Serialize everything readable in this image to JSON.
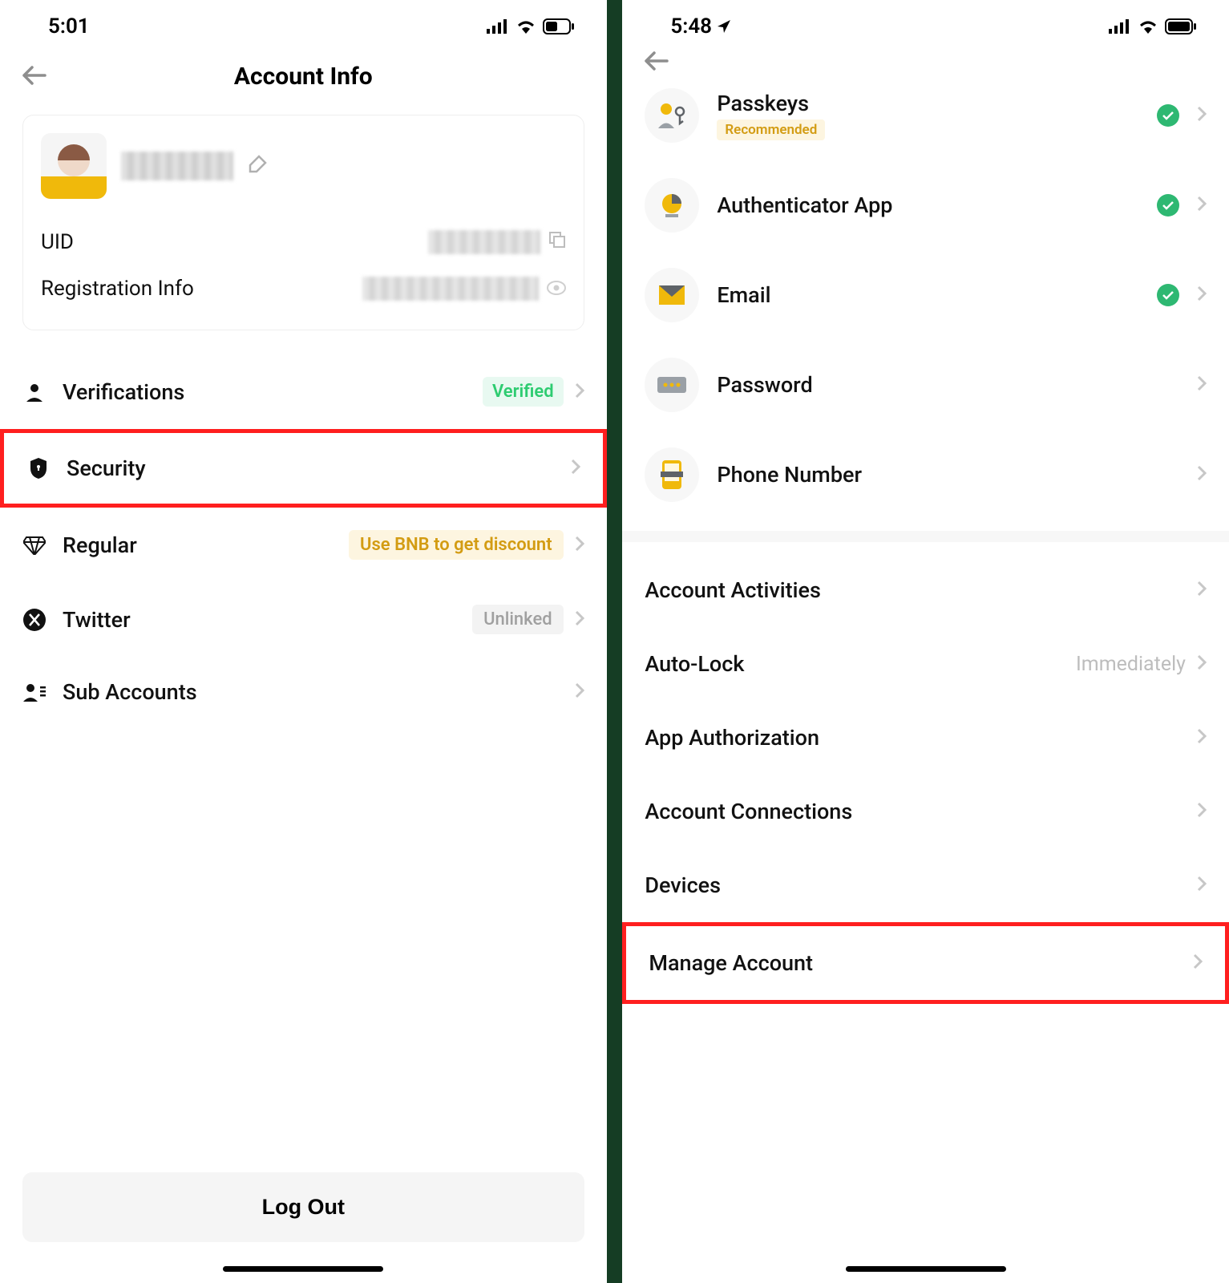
{
  "left": {
    "status_time": "5:01",
    "page_title": "Account Info",
    "card": {
      "uid_label": "UID",
      "reg_label": "Registration Info"
    },
    "items": {
      "verifications": {
        "label": "Verifications",
        "badge": "Verified"
      },
      "security": {
        "label": "Security"
      },
      "regular": {
        "label": "Regular",
        "badge": "Use BNB to get discount"
      },
      "twitter": {
        "label": "Twitter",
        "badge": "Unlinked"
      },
      "sub_accounts": {
        "label": "Sub Accounts"
      }
    },
    "logout_label": "Log Out"
  },
  "right": {
    "status_time": "5:48",
    "sec_items": {
      "passkeys": {
        "label": "Passkeys",
        "sub": "Recommended",
        "checked": true
      },
      "authenticator": {
        "label": "Authenticator App",
        "checked": true
      },
      "email": {
        "label": "Email",
        "checked": true
      },
      "password": {
        "label": "Password",
        "checked": false
      },
      "phone": {
        "label": "Phone Number",
        "checked": false
      }
    },
    "plain_items": {
      "activities": {
        "label": "Account Activities"
      },
      "autolock": {
        "label": "Auto-Lock",
        "value": "Immediately"
      },
      "appauth": {
        "label": "App Authorization"
      },
      "connections": {
        "label": "Account Connections"
      },
      "devices": {
        "label": "Devices"
      },
      "manage": {
        "label": "Manage Account"
      }
    }
  }
}
